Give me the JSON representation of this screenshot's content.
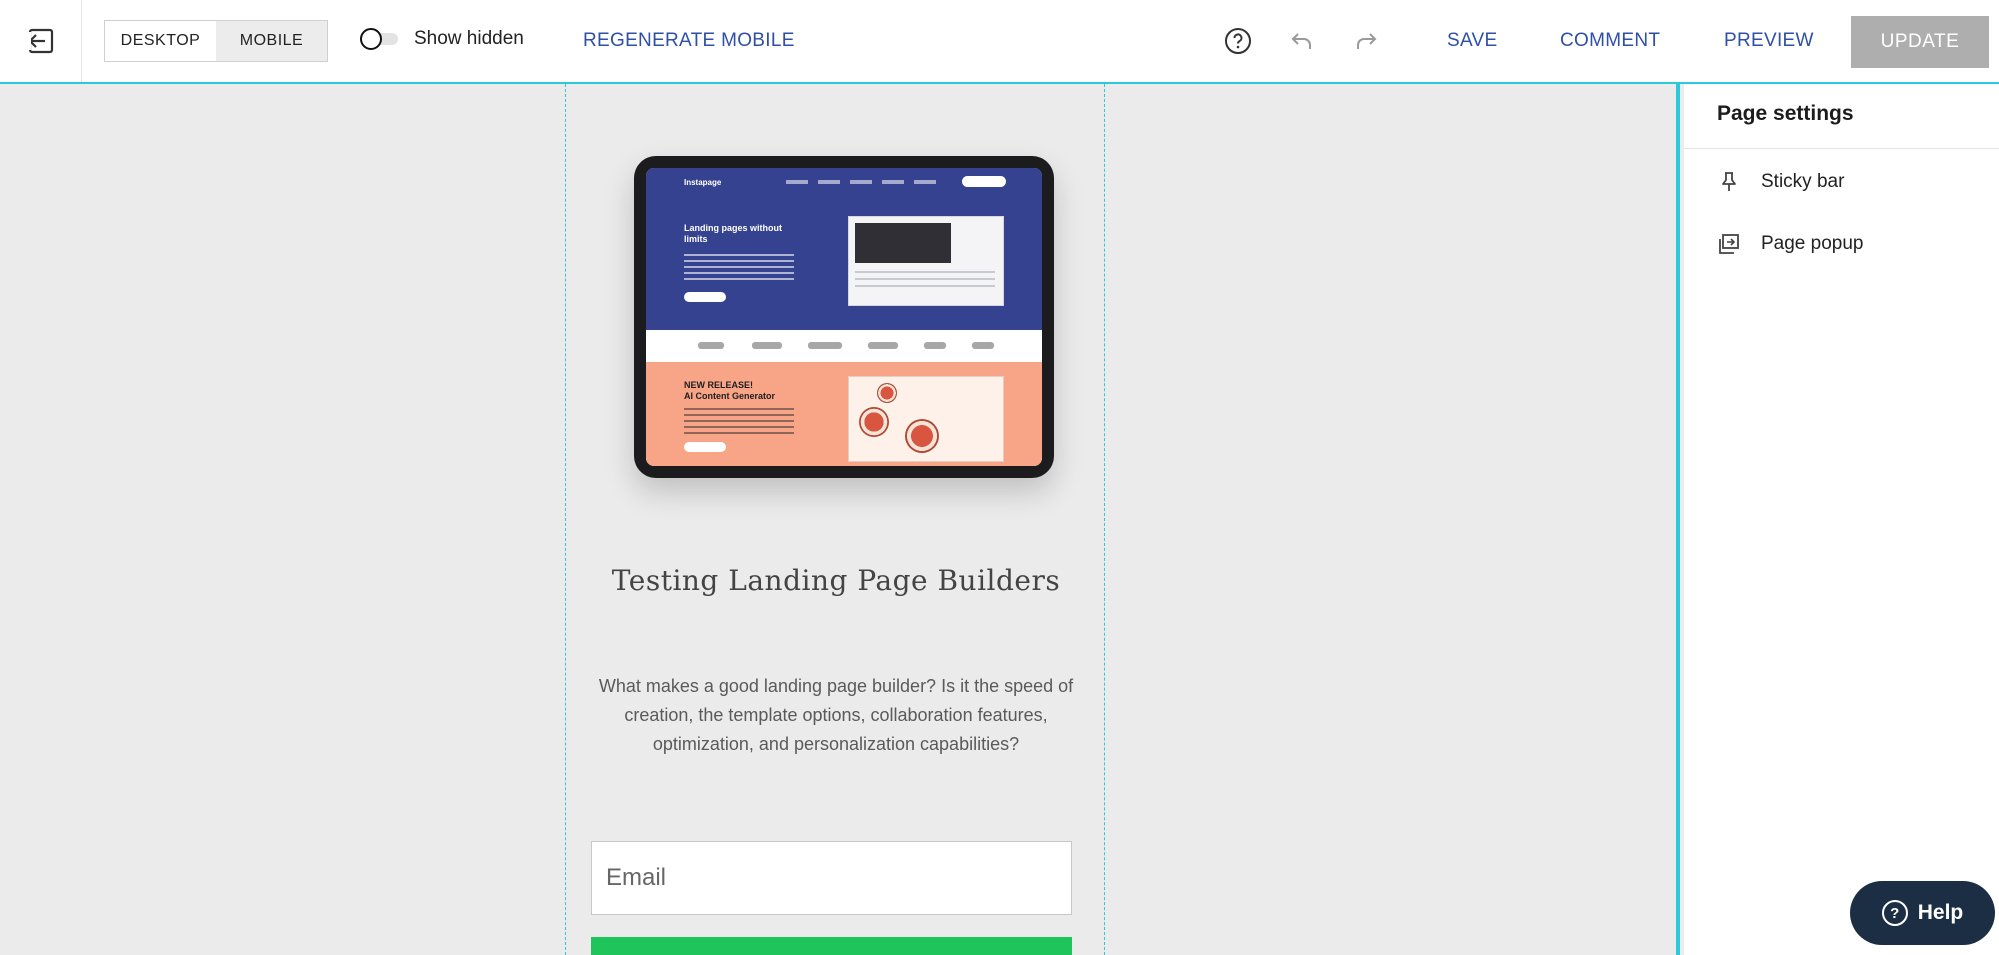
{
  "toolbar": {
    "view_options": [
      "DESKTOP",
      "MOBILE"
    ],
    "active_view": "MOBILE",
    "show_hidden_label": "Show hidden",
    "regenerate_label": "REGENERATE MOBILE",
    "save_label": "SAVE",
    "comment_label": "COMMENT",
    "preview_label": "PREVIEW",
    "update_label": "UPDATE",
    "icons": [
      "exit-icon",
      "help-circle-icon",
      "undo-icon",
      "redo-icon"
    ]
  },
  "canvas": {
    "mockup": {
      "brand": "Instapage",
      "hero_heading": "Landing pages without limits",
      "release_heading_1": "NEW RELEASE!",
      "release_heading_2": "AI Content Generator"
    },
    "headline": "Testing Landing Page Builders",
    "description": "What makes a good landing page builder? Is it the speed of creation, the template options, collaboration features, optimization, and personalization capabilities?",
    "email_placeholder": "Email"
  },
  "panel": {
    "title": "Page settings",
    "items": [
      {
        "label": "Sticky bar",
        "icon": "pin-icon"
      },
      {
        "label": "Page popup",
        "icon": "popup-icon"
      }
    ]
  },
  "help": {
    "label": "Help"
  },
  "colors": {
    "accent": "#2ec9d8",
    "link": "#2f4fa8",
    "update_disabled": "#aeaeae",
    "help_bg": "#1c2e44",
    "cta_green": "#1fc45a"
  }
}
